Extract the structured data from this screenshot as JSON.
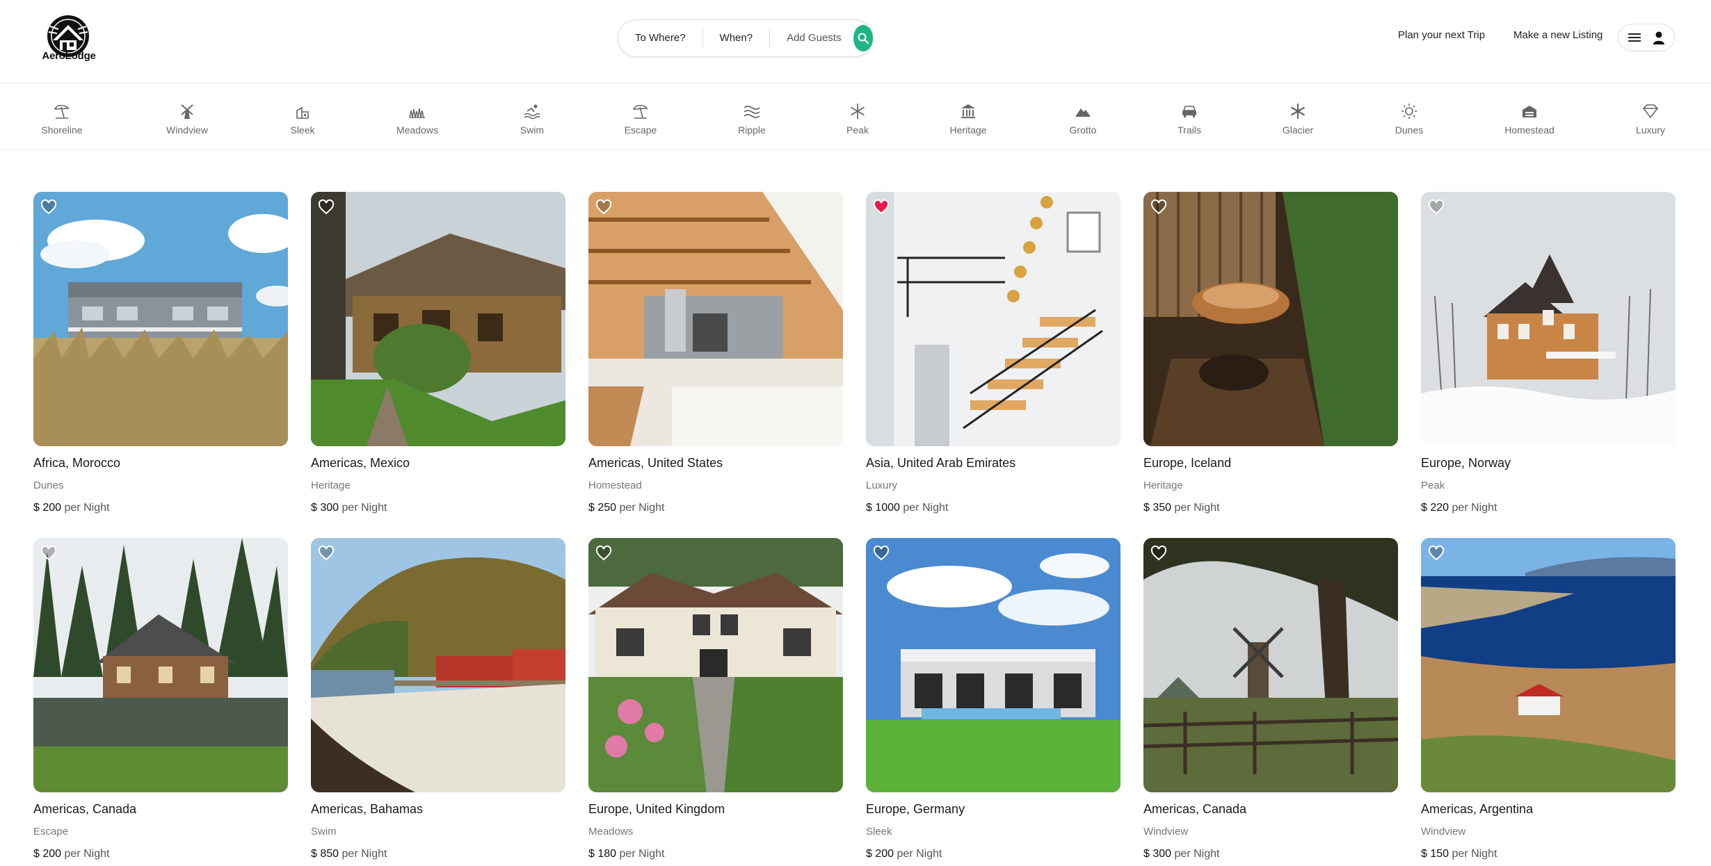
{
  "brand": {
    "name": "AeroLodge"
  },
  "search": {
    "where_label": "To Where?",
    "when_label": "When?",
    "guests_label": "Add Guests",
    "button_icon": "search-icon",
    "accent": "#1fb587"
  },
  "nav": {
    "plan_label": "Plan your next Trip",
    "listing_label": "Make a new Listing",
    "menu_icon": "hamburger-menu-icon",
    "user_icon": "user-icon"
  },
  "categories": [
    {
      "label": "Shoreline",
      "icon": "beach-umbrella-icon"
    },
    {
      "label": "Windview",
      "icon": "windmill-icon"
    },
    {
      "label": "Sleek",
      "icon": "modern-house-icon"
    },
    {
      "label": "Meadows",
      "icon": "grass-icon"
    },
    {
      "label": "Swim",
      "icon": "swimmer-icon"
    },
    {
      "label": "Escape",
      "icon": "beach-umbrella-icon"
    },
    {
      "label": "Ripple",
      "icon": "waves-icon"
    },
    {
      "label": "Peak",
      "icon": "snowflake-icon"
    },
    {
      "label": "Heritage",
      "icon": "museum-icon"
    },
    {
      "label": "Grotto",
      "icon": "mountain-icon"
    },
    {
      "label": "Trails",
      "icon": "car-icon"
    },
    {
      "label": "Glacier",
      "icon": "snowflake-icon"
    },
    {
      "label": "Dunes",
      "icon": "sun-icon"
    },
    {
      "label": "Homestead",
      "icon": "barn-icon"
    },
    {
      "label": "Luxury",
      "icon": "diamond-icon"
    }
  ],
  "price_suffix": "per Night",
  "currency": "$",
  "listings": [
    {
      "location": "Africa, Morocco",
      "category": "Dunes",
      "price": "200",
      "favorite": false,
      "scene": "beach-house"
    },
    {
      "location": "Americas, Mexico",
      "category": "Heritage",
      "price": "300",
      "favorite": false,
      "scene": "thatched-cottage"
    },
    {
      "location": "Americas, United States",
      "category": "Homestead",
      "price": "250",
      "favorite": false,
      "scene": "wood-interior"
    },
    {
      "location": "Asia, United Arab Emirates",
      "category": "Luxury",
      "price": "1000",
      "favorite": true,
      "scene": "white-staircase"
    },
    {
      "location": "Europe, Iceland",
      "category": "Heritage",
      "price": "350",
      "favorite": false,
      "scene": "wood-bathtub"
    },
    {
      "location": "Europe, Norway",
      "category": "Peak",
      "price": "220",
      "favorite": false,
      "scene": "snowy-victorian"
    },
    {
      "location": "Americas, Canada",
      "category": "Escape",
      "price": "200",
      "favorite": false,
      "scene": "lake-cabin"
    },
    {
      "location": "Americas, Bahamas",
      "category": "Swim",
      "price": "850",
      "favorite": false,
      "scene": "red-boathouse"
    },
    {
      "location": "Europe, United Kingdom",
      "category": "Meadows",
      "price": "180",
      "favorite": false,
      "scene": "garden-cottage"
    },
    {
      "location": "Europe, Germany",
      "category": "Sleek",
      "price": "200",
      "favorite": false,
      "scene": "modern-villa"
    },
    {
      "location": "Americas, Canada",
      "category": "Windview",
      "price": "300",
      "favorite": false,
      "scene": "windmill-field"
    },
    {
      "location": "Americas, Argentina",
      "category": "Windview",
      "price": "150",
      "favorite": false,
      "scene": "sea-cliff"
    }
  ],
  "colors": {
    "heart_active": "#e8194b",
    "heart_inactive": "#ffffff"
  }
}
